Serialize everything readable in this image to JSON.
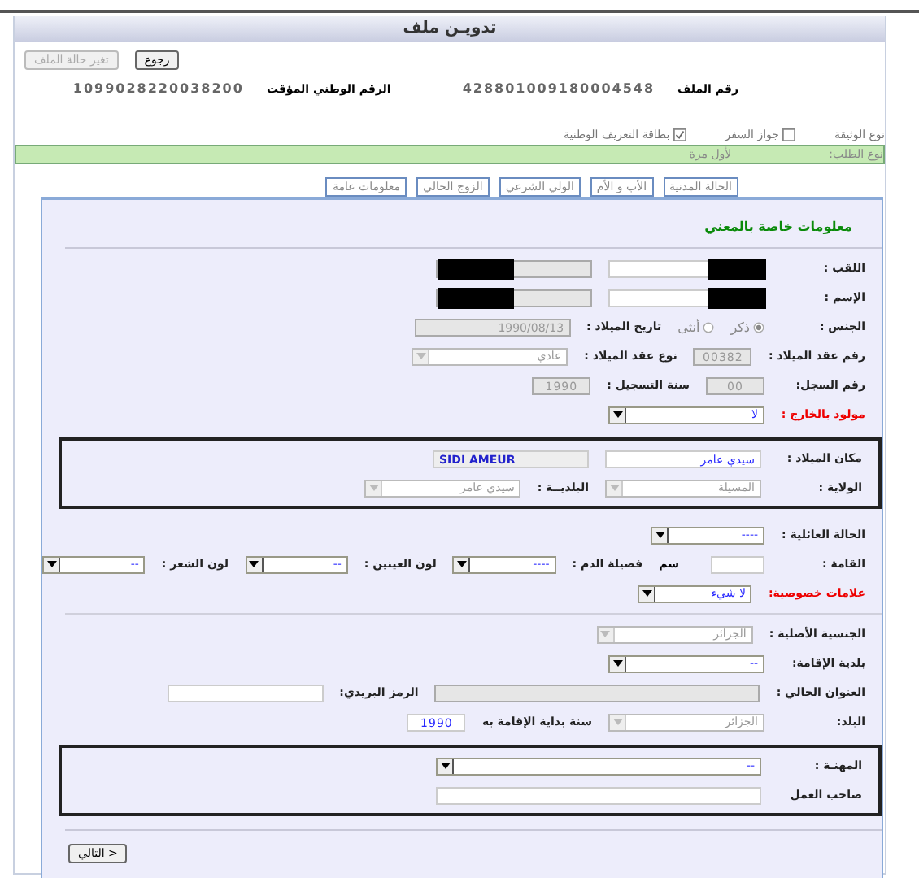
{
  "window": {
    "title": "تدويـن ملف"
  },
  "buttons": [
    {
      "label": "رجوع",
      "disabled": false
    },
    {
      "label": "تغير حالة الملف",
      "disabled": true
    }
  ],
  "ids": [
    {
      "label": "رقم الملف",
      "value": "428801009180004548"
    },
    {
      "label": "الرقم الوطني المؤقت",
      "value": "1099028220038200"
    }
  ],
  "document_type": {
    "label": "نوع الوثيقة",
    "options": [
      {
        "label": "جواز السفر",
        "checked": false
      },
      {
        "label": "بطاقة التعريف الوطنية",
        "checked": true
      }
    ]
  },
  "request_type": {
    "label": "نوع الطلب:",
    "value": "لأول مرة"
  },
  "tabs": [
    {
      "label": "الحالة المدنية",
      "selected": false
    },
    {
      "label": "الأب و الأم",
      "selected": false
    },
    {
      "label": "الولي الشرعي",
      "selected": false
    },
    {
      "label": "الزوج الحالي",
      "selected": false
    },
    {
      "label": "معلومات عامة",
      "selected": false
    }
  ],
  "section_title": "معلومات خاصة بالمعني",
  "sections": [
    {
      "kind": "plain",
      "rows": [
        {
          "items": [
            {
              "kind": "label",
              "text": "اللقب :"
            },
            {
              "kind": "input",
              "redacted": true,
              "disabled": false
            },
            {
              "kind": "input",
              "redacted": true,
              "disabled": true
            }
          ]
        },
        {
          "items": [
            {
              "kind": "label",
              "text": "الإسم :"
            },
            {
              "kind": "input",
              "redacted": true,
              "disabled": false
            },
            {
              "kind": "input",
              "redacted": true,
              "disabled": true
            }
          ]
        },
        {
          "items": [
            {
              "kind": "label",
              "text": "الجنس :"
            },
            {
              "kind": "radio",
              "text": "ذكر",
              "selected": true
            },
            {
              "kind": "radio",
              "text": "أنثى",
              "selected": false
            },
            {
              "kind": "label",
              "text": "تاريخ الميلاد :"
            },
            {
              "kind": "input",
              "value": "1990/08/13",
              "disabled": true
            }
          ]
        },
        {
          "items": [
            {
              "kind": "label",
              "text": "رقم عقد الميلاد :"
            },
            {
              "kind": "short-input",
              "value": "00382",
              "disabled": true
            },
            {
              "kind": "label",
              "text": "نوع عقد الميلاد :"
            },
            {
              "kind": "select",
              "value": "عادي",
              "disabled": true
            }
          ]
        },
        {
          "items": [
            {
              "kind": "label",
              "text": "رقم السجل:"
            },
            {
              "kind": "short-input",
              "value": "00",
              "disabled": true
            },
            {
              "kind": "label",
              "text": "سنة التسجيل :"
            },
            {
              "kind": "short-input",
              "value": "1990",
              "disabled": true
            }
          ]
        },
        {
          "items": [
            {
              "kind": "warning-label",
              "text": "مولود بالخارج :"
            },
            {
              "kind": "select",
              "value": "لا",
              "disabled": false
            }
          ]
        }
      ]
    },
    {
      "kind": "boxed",
      "rows": [
        {
          "items": [
            {
              "kind": "label",
              "text": "مكان الميلاد :"
            },
            {
              "kind": "input",
              "value": "سيدي عامر",
              "disabled": false
            },
            {
              "kind": "latin-output",
              "value": "SIDI AMEUR"
            }
          ]
        },
        {
          "items": [
            {
              "kind": "label",
              "text": "الولاية :"
            },
            {
              "kind": "select",
              "value": "المسيلة",
              "disabled": true
            },
            {
              "kind": "label",
              "text": "البلديــة :"
            },
            {
              "kind": "select",
              "value": "سيدي عامر",
              "disabled": true
            }
          ]
        }
      ]
    },
    {
      "kind": "plain",
      "rows": [
        {
          "items": [
            {
              "kind": "label",
              "text": "الحالة العائلية :"
            },
            {
              "kind": "small-select",
              "value": "----",
              "disabled": false
            }
          ]
        },
        {
          "items": [
            {
              "kind": "label",
              "text": "القامة :"
            },
            {
              "kind": "short-input",
              "disabled": false
            },
            {
              "kind": "unit",
              "text": "سم"
            },
            {
              "kind": "label",
              "text": "فصيلة الدم :"
            },
            {
              "kind": "small-select",
              "value": "----",
              "disabled": false
            },
            {
              "kind": "label",
              "text": "لون العينين :"
            },
            {
              "kind": "small-select",
              "value": "--",
              "disabled": false
            },
            {
              "kind": "label",
              "text": "لون الشعر :"
            },
            {
              "kind": "small-select",
              "value": "--",
              "disabled": false
            }
          ]
        },
        {
          "items": [
            {
              "kind": "warning-label",
              "text": "علامات خصوصية:"
            },
            {
              "kind": "small-select",
              "value": "لا شيء",
              "disabled": false
            }
          ]
        }
      ]
    },
    {
      "kind": "ruled",
      "rows": [
        {
          "items": [
            {
              "kind": "label",
              "text": "الجنسية الأصلية :"
            },
            {
              "kind": "select",
              "value": "الجزائر",
              "disabled": true
            }
          ]
        },
        {
          "items": [
            {
              "kind": "label",
              "text": "بلدية الإقامة:"
            },
            {
              "kind": "select",
              "value": "--",
              "disabled": false
            }
          ]
        },
        {
          "items": [
            {
              "kind": "label",
              "text": "العنوان الحالي :"
            },
            {
              "kind": "wide-input",
              "disabled": true
            },
            {
              "kind": "label",
              "text": "الرمز البريدي:"
            },
            {
              "kind": "input",
              "disabled": false
            }
          ]
        },
        {
          "items": [
            {
              "kind": "label",
              "text": "البلد:"
            },
            {
              "kind": "select",
              "value": "الجزائر",
              "disabled": true
            },
            {
              "kind": "label",
              "text": "سنة بداية الإقامة به"
            },
            {
              "kind": "short-input",
              "value": "1990",
              "disabled": false
            }
          ]
        }
      ]
    },
    {
      "kind": "boxed",
      "rows": [
        {
          "items": [
            {
              "kind": "label",
              "text": "المهنـة :"
            },
            {
              "kind": "wide-select",
              "value": "--",
              "disabled": false
            }
          ]
        },
        {
          "items": [
            {
              "kind": "label",
              "text": "صاحب العمل"
            },
            {
              "kind": "wide-input",
              "disabled": false
            }
          ]
        }
      ]
    }
  ],
  "next_button": {
    "label": "التالي >"
  }
}
